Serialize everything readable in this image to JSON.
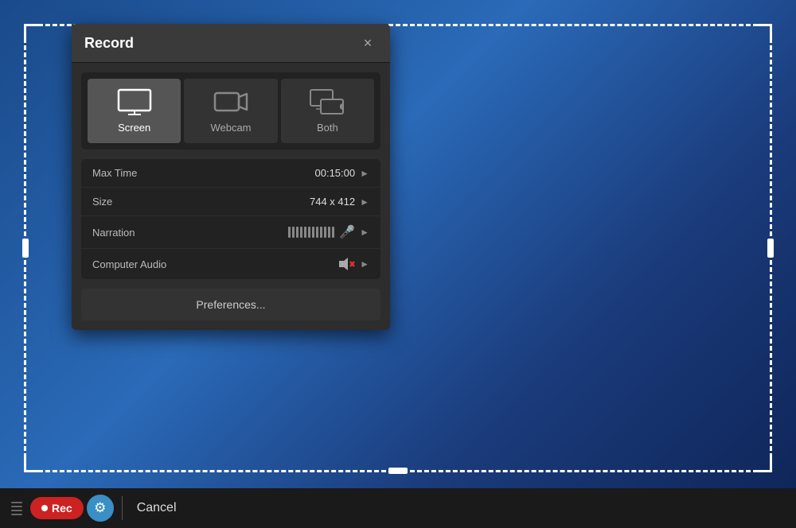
{
  "background": {
    "gradient_desc": "blue desktop gradient"
  },
  "dialog": {
    "title": "Record",
    "close_label": "×"
  },
  "modes": [
    {
      "id": "screen",
      "label": "Screen",
      "active": true
    },
    {
      "id": "webcam",
      "label": "Webcam",
      "active": false
    },
    {
      "id": "both",
      "label": "Both",
      "active": false
    }
  ],
  "settings": [
    {
      "label": "Max Time",
      "value": "00:15:00",
      "has_chevron": true
    },
    {
      "label": "Size",
      "value": "744 x 412",
      "has_chevron": true
    },
    {
      "label": "Narration",
      "value": "bars_mic",
      "has_chevron": true
    },
    {
      "label": "Computer Audio",
      "value": "muted",
      "has_chevron": true
    }
  ],
  "preferences_label": "Preferences...",
  "toolbar": {
    "rec_label": "Rec",
    "cancel_label": "Cancel"
  }
}
